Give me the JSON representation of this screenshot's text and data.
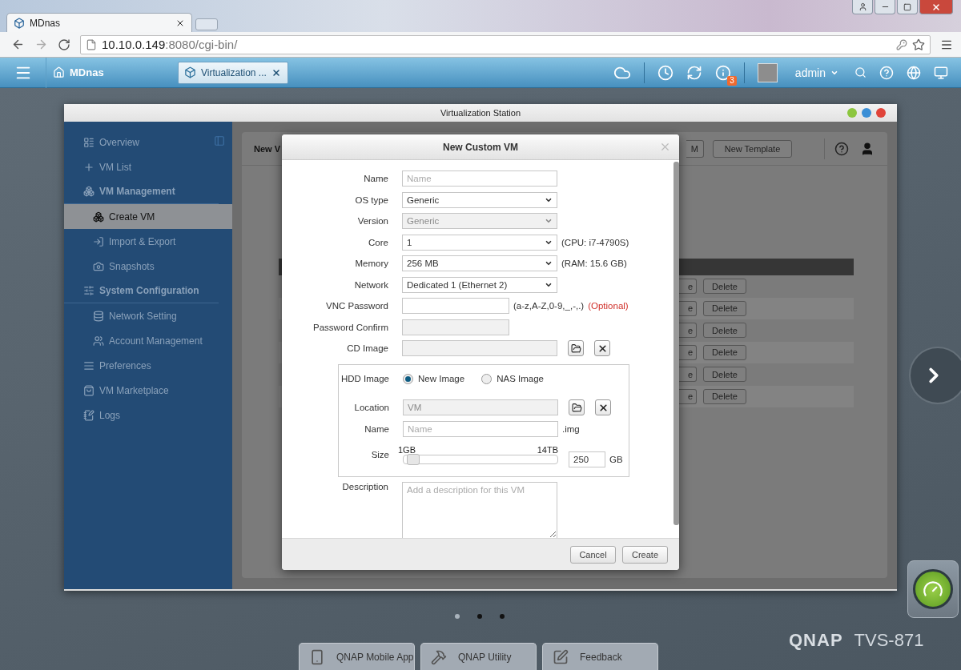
{
  "browser": {
    "tabs": [
      {
        "title": "MDnas",
        "selected": true
      }
    ],
    "url_host": "10.10.0.149",
    "url_path": ":8080/cgi-bin/"
  },
  "topbar": {
    "home": "MDnas",
    "apps": [
      {
        "label": "Virtualization ...",
        "selected": true
      }
    ],
    "badge": "3",
    "user": "admin"
  },
  "window": {
    "title": "Virtualization Station"
  },
  "sidebar": {
    "items": [
      {
        "label": "Overview",
        "kind": "link",
        "selected": false
      },
      {
        "label": "VM List",
        "kind": "link",
        "selected": false
      },
      {
        "label": "VM Management",
        "kind": "group",
        "selected": false,
        "children": [
          {
            "label": "Create VM",
            "selected": true
          },
          {
            "label": "Import & Export",
            "selected": false
          },
          {
            "label": "Snapshots",
            "selected": false
          }
        ]
      },
      {
        "label": "System Configuration",
        "kind": "group",
        "selected": false,
        "children": [
          {
            "label": "Network Setting",
            "selected": false
          },
          {
            "label": "Account Management",
            "selected": false
          }
        ]
      },
      {
        "label": "Preferences",
        "kind": "link",
        "selected": false
      },
      {
        "label": "VM Marketplace",
        "kind": "link",
        "selected": false
      },
      {
        "label": "Logs",
        "kind": "link",
        "selected": false
      }
    ]
  },
  "main": {
    "title": "New V",
    "toolbar_buttons": [
      {
        "label": "M",
        "kind": "partial"
      },
      {
        "label": "New Template",
        "kind": "full"
      }
    ],
    "rows": [
      {
        "button_1": "e",
        "button_2": "Delete"
      },
      {
        "button_1": "e",
        "button_2": "Delete"
      },
      {
        "button_1": "e",
        "button_2": "Delete"
      },
      {
        "button_1": "e",
        "button_2": "Delete"
      },
      {
        "button_1": "e",
        "button_2": "Delete"
      },
      {
        "button_1": "e",
        "button_2": "Delete"
      }
    ]
  },
  "dialog": {
    "title": "New Custom VM",
    "fields": [
      {
        "label": "Name",
        "kind": "text",
        "placeholder": "Name",
        "disabled": false
      },
      {
        "label": "OS type",
        "kind": "select",
        "value": "Generic",
        "disabled": false
      },
      {
        "label": "Version",
        "kind": "select",
        "value": "Generic",
        "disabled": true
      },
      {
        "label": "Core",
        "kind": "select",
        "value": "1",
        "note": "(CPU: i7-4790S)",
        "disabled": false
      },
      {
        "label": "Memory",
        "kind": "select",
        "value": "256 MB",
        "note": "(RAM: 15.6 GB)",
        "disabled": false
      },
      {
        "label": "Network",
        "kind": "select",
        "value": "Dedicated 1 (Ethernet 2)",
        "disabled": false
      },
      {
        "label": "VNC Password",
        "kind": "password",
        "note": "(a-z,A-Z,0-9,_,-,.)",
        "optional": "(Optional)",
        "disabled": false
      },
      {
        "label": "Password Confirm",
        "kind": "password",
        "disabled": true
      },
      {
        "label": "CD Image",
        "kind": "file",
        "disabled": true
      }
    ],
    "hdd": {
      "label": "HDD Image",
      "options": [
        {
          "label": "New Image",
          "selected": true
        },
        {
          "label": "NAS Image",
          "selected": false
        }
      ],
      "location": {
        "label": "Location",
        "value": "VM",
        "disabled": true
      },
      "name": {
        "label": "Name",
        "placeholder": "Name",
        "suffix": ".img"
      },
      "size": {
        "label": "Size",
        "min": "1GB",
        "max": "14TB",
        "level": 0.02,
        "value": "250",
        "unit": "GB"
      }
    },
    "description": {
      "label": "Description",
      "placeholder": "Add a description for this VM"
    },
    "buttons": [
      "Cancel",
      "Create"
    ]
  },
  "desktop": {
    "pages": [
      {
        "selected": true
      },
      {
        "selected": false
      },
      {
        "selected": false
      }
    ],
    "brand": "QNAP",
    "model": "TVS-871",
    "dock": [
      "QNAP Mobile App",
      "QNAP Utility",
      "Feedback"
    ]
  }
}
